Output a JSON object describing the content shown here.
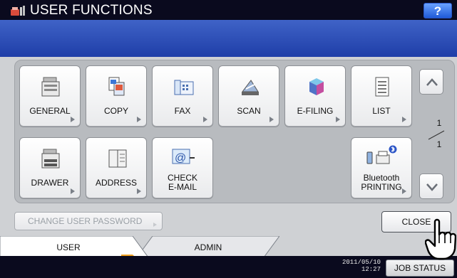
{
  "header": {
    "title": "USER FUNCTIONS",
    "help_label": "?"
  },
  "functions": [
    {
      "label": "GENERAL",
      "icon": "general-icon"
    },
    {
      "label": "COPY",
      "icon": "copy-icon"
    },
    {
      "label": "FAX",
      "icon": "fax-icon"
    },
    {
      "label": "SCAN",
      "icon": "scan-icon"
    },
    {
      "label": "E-FILING",
      "icon": "efiling-icon"
    },
    {
      "label": "LIST",
      "icon": "list-icon"
    },
    {
      "label": "DRAWER",
      "icon": "drawer-icon"
    },
    {
      "label": "ADDRESS",
      "icon": "address-book-icon"
    },
    {
      "label_line1": "CHECK",
      "label_line2": "E-MAIL",
      "icon": "email-icon"
    },
    {
      "label_line1": "Bluetooth",
      "label_line2": "PRINTING",
      "icon": "bluetooth-printing-icon"
    }
  ],
  "pager": {
    "current": "1",
    "total": "1"
  },
  "actions": {
    "change_password": "CHANGE USER PASSWORD",
    "close": "CLOSE"
  },
  "tabs": [
    {
      "label": "USER",
      "active": true
    },
    {
      "label": "ADMIN",
      "active": false
    }
  ],
  "footer": {
    "date": "2011/05/10",
    "time": "12:27",
    "job_status": "JOB STATUS"
  },
  "colors": {
    "titlebar": "#0a0a1e",
    "blueband": "#2b4fb8",
    "tab_accent": "#f0a020"
  }
}
